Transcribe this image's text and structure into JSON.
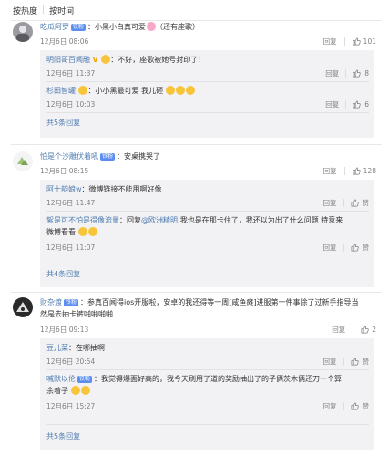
{
  "sort_bar": {
    "hot": "按热度",
    "sep": "|",
    "time": "按时间"
  },
  "actions": {
    "reply": "回复"
  },
  "comments": [
    {
      "user": "吃瓜阿罗",
      "badge": "铁粉",
      "text": "：小黑小白真可爱",
      "text_suffix": "（还有座歌）",
      "time": "12月6日 08:06",
      "likes": "101",
      "replies": [
        {
          "user": "明阳哥百闻融",
          "text": "：不好，座歌被她号封印了！",
          "time": "12月6日 11:37",
          "likes": "8"
        },
        {
          "user": "杉田智罐",
          "text": "：小小黑最可爱 我儿砸",
          "time": "12月6日 10:03",
          "likes": "6"
        }
      ],
      "more": "共5条回复"
    },
    {
      "user": "怕是个沙雕伏着吼",
      "badge": "铁粉",
      "text": "：安桌携哭了",
      "time": "12月6日 08:15",
      "likes": "128",
      "replies": [
        {
          "user": "阿十韵娘w",
          "text": "：微博链接不能用啊好像",
          "time": "12月6日 11:47",
          "likes": "赞"
        },
        {
          "user": "絮是可不怕是得像流量",
          "text": "：回复",
          "mention": "@欧洲精明",
          "text2": ":我也是在那卡住了，我还以为出了什么问题 特意来",
          "text3": "微博看看",
          "time": "12月6日 11:07",
          "likes": "赞"
        }
      ],
      "more": "共4条回复"
    },
    {
      "user": "财杂渡",
      "badge": "铁粉",
      "text": "：参真百闻得ios开服啦，安卓的我还得等一周[咸鱼瘫]进服第一件事除了过新手指导当",
      "text_line2": "然是去抽卡裤啪啪啪啪",
      "time": "12月6日 09:13",
      "likes": "2",
      "replies": [
        {
          "user": "豆儿菜",
          "text": "：在哪抽啊",
          "time": "12月6日 20:54",
          "likes": "赞"
        },
        {
          "user": "喊默以伦",
          "text": "：我觉得爆面好高的，我今天刷用了道的奖励抽出了的子俩茨木俩还刀一个算",
          "text_line2": "余着子",
          "time": "12月6日 15:27",
          "likes": "赞"
        }
      ],
      "more": "共5条回复"
    }
  ],
  "colors": {
    "accent": "#eb7350",
    "link": "#507daf",
    "badge": "#5c8ef0",
    "reply_bg": "#f2f2f5"
  }
}
